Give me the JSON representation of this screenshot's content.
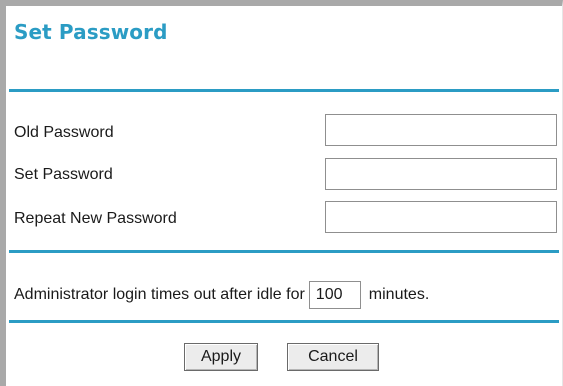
{
  "page": {
    "title": "Set Password"
  },
  "form": {
    "old_password_label": "Old Password",
    "set_password_label": "Set Password",
    "repeat_password_label": "Repeat New Password",
    "timeout_prefix": "Administrator login times out after idle for",
    "timeout_value": "100",
    "timeout_suffix": "minutes."
  },
  "buttons": {
    "apply_label": "Apply",
    "cancel_label": "Cancel"
  },
  "colors": {
    "accent": "#2b9cc4",
    "frame": "#a9a9a9"
  }
}
